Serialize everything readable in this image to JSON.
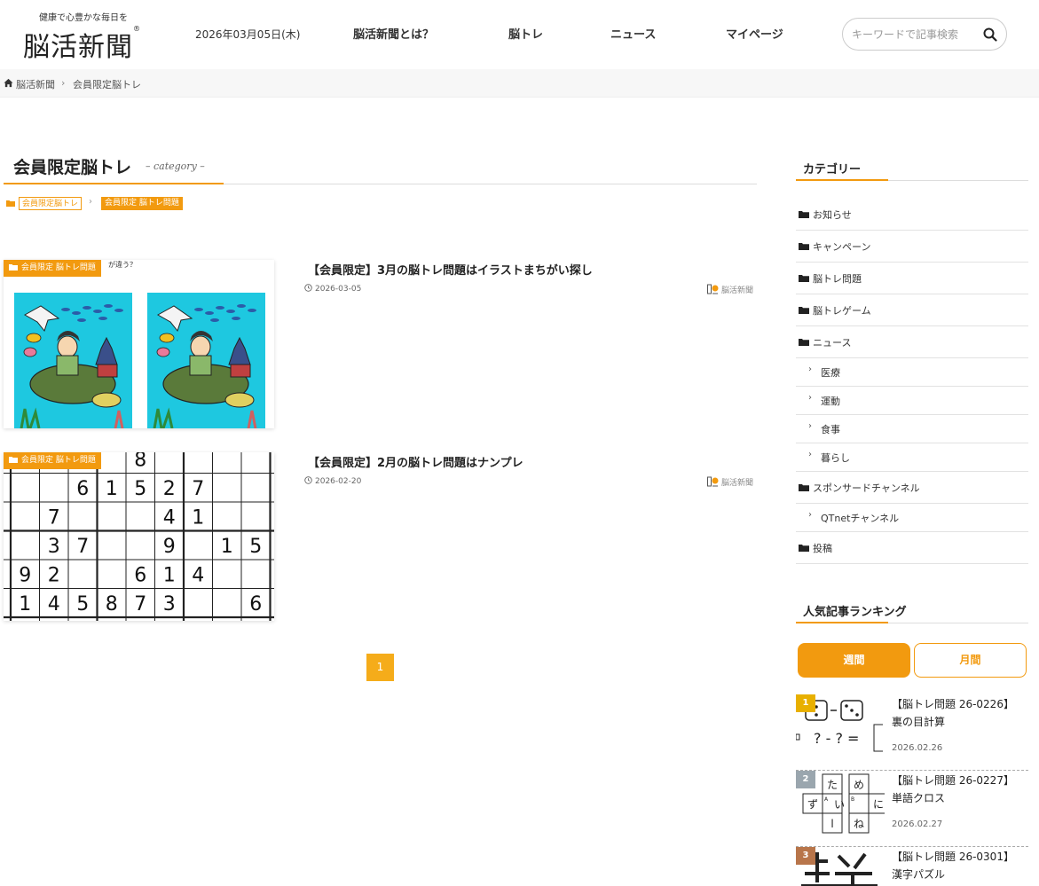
{
  "header": {
    "logo_tagline": "健康で心豊かな毎日を",
    "logo_text": "脳活新聞",
    "date": "2026年03月05日(木)",
    "nav": [
      "脳活新聞とは？",
      "脳トレ",
      "ニュース",
      "マイページ"
    ],
    "search_placeholder": "キーワードで記事検索"
  },
  "breadcrumb": {
    "home": "脳活新聞",
    "separator": "›",
    "current": "会員限定脳トレ"
  },
  "main": {
    "title": "会員限定脳トレ",
    "subtitle": "– category –",
    "tags": {
      "parent": "会員限定脳トレ",
      "separator": "›",
      "child": "会員限定 脳トレ問題"
    },
    "articles": [
      {
        "badge": "会員限定 脳トレ問題",
        "title": "【会員限定】3月の脳トレ問題はイラストまちがい探し",
        "date": "2026-03-05",
        "author": "脳活新聞",
        "thumb_caption": "が違う？"
      },
      {
        "badge": "会員限定 脳トレ問題",
        "title": "【会員限定】2月の脳トレ問題はナンプレ",
        "date": "2026-02-20",
        "author": "脳活新聞",
        "sudoku_rows": [
          [
            "",
            "",
            "",
            "",
            "8",
            "",
            "",
            "",
            ""
          ],
          [
            "",
            "",
            "6",
            "1",
            "5",
            "2",
            "7",
            "",
            ""
          ],
          [
            "",
            "7",
            "",
            "",
            "",
            "4",
            "1",
            "",
            ""
          ],
          [
            "",
            "3",
            "7",
            "",
            "",
            "9",
            "",
            "1",
            "5"
          ],
          [
            "9",
            "2",
            "",
            "",
            "6",
            "1",
            "4",
            "",
            ""
          ],
          [
            "1",
            "4",
            "5",
            "8",
            "7",
            "3",
            "",
            "",
            "6"
          ]
        ]
      }
    ],
    "pagination": {
      "current": "1"
    }
  },
  "sidebar": {
    "category_heading": "カテゴリー",
    "categories": [
      {
        "label": "お知らせ",
        "sub": false
      },
      {
        "label": "キャンペーン",
        "sub": false
      },
      {
        "label": "脳トレ問題",
        "sub": false
      },
      {
        "label": "脳トレゲーム",
        "sub": false
      },
      {
        "label": "ニュース",
        "sub": false
      },
      {
        "label": "医療",
        "sub": true
      },
      {
        "label": "運動",
        "sub": true
      },
      {
        "label": "食事",
        "sub": true
      },
      {
        "label": "暮らし",
        "sub": true
      },
      {
        "label": "スポンサードチャンネル",
        "sub": false
      },
      {
        "label": "QTnetチャンネル",
        "sub": true
      },
      {
        "label": "投稿",
        "sub": false
      }
    ],
    "ranking_heading": "人気記事ランキング",
    "ranking_tabs": {
      "week": "週間",
      "month": "月間"
    },
    "ranking": [
      {
        "rank": "1",
        "title_1": "【脳トレ問題 26-0226】",
        "title_2": "裏の目計算",
        "date": "2026.02.26",
        "color": "#e8b000"
      },
      {
        "rank": "2",
        "title_1": "【脳トレ問題 26-0227】",
        "title_2": "単語クロス",
        "date": "2026.02.27",
        "color": "#9aa6ae"
      },
      {
        "rank": "3",
        "title_1": "【脳トレ問題 26-0301】",
        "title_2": "漢字パズル",
        "date": "",
        "color": "#b8754a"
      }
    ],
    "rank1_thumb": {
      "eq": "? - ? ="
    },
    "rank2_thumb": {
      "cells": [
        "た",
        "め",
        "ず",
        "A",
        "い",
        "B",
        "に",
        "l",
        "ね"
      ]
    }
  },
  "colors": {
    "accent": "#f29a0f",
    "pagination": "#f5ac1a"
  }
}
